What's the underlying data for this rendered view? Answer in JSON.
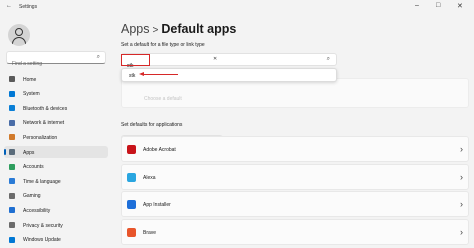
{
  "window": {
    "title": "Settings",
    "back_glyph": "←",
    "minimize_glyph": "–",
    "maximize_glyph": "□",
    "close_glyph": "✕"
  },
  "sidebar": {
    "search_placeholder": "Find a setting",
    "search_glyph": "⌕",
    "items": [
      {
        "label": "Home",
        "icon": "home-icon",
        "color": "#5a5a5a"
      },
      {
        "label": "System",
        "icon": "system-icon",
        "color": "#0078d4"
      },
      {
        "label": "Bluetooth & devices",
        "icon": "bluetooth-icon",
        "color": "#0a7fd6"
      },
      {
        "label": "Network & internet",
        "icon": "network-icon",
        "color": "#4a6da7"
      },
      {
        "label": "Personalization",
        "icon": "brush-icon",
        "color": "#d17a2b"
      },
      {
        "label": "Apps",
        "icon": "apps-icon",
        "color": "#5a6b7a",
        "active": true
      },
      {
        "label": "Accounts",
        "icon": "accounts-icon",
        "color": "#2e9e5e"
      },
      {
        "label": "Time & language",
        "icon": "time-icon",
        "color": "#2a7bd6"
      },
      {
        "label": "Gaming",
        "icon": "gaming-icon",
        "color": "#6b6b6b"
      },
      {
        "label": "Accessibility",
        "icon": "accessibility-icon",
        "color": "#1f6fd1"
      },
      {
        "label": "Privacy & security",
        "icon": "shield-icon",
        "color": "#6b6b6b"
      },
      {
        "label": "Windows Update",
        "icon": "update-icon",
        "color": "#0078d4"
      }
    ]
  },
  "main": {
    "breadcrumb_parent": "Apps",
    "breadcrumb_sep": ">",
    "breadcrumb_current": "Default apps",
    "filetype_heading": "Set a default for a file type or link type",
    "filetype_value": "stk",
    "clear_glyph": "✕",
    "search_glyph": "⌕",
    "suggestion": "stk",
    "ghost_text": "Choose a default",
    "apps_heading": "Set defaults for applications",
    "apps_search_placeholder": "Search apps",
    "chevron_glyph": "›",
    "apps": [
      {
        "name": "Adobe Acrobat",
        "icon": "adobe-acrobat-icon",
        "color": "#c8141a"
      },
      {
        "name": "Alexa",
        "icon": "alexa-icon",
        "color": "#2aa6e0"
      },
      {
        "name": "App Installer",
        "icon": "app-installer-icon",
        "color": "#1e6fd9"
      },
      {
        "name": "Brave",
        "icon": "brave-icon",
        "color": "#e8552b"
      }
    ]
  },
  "annotation_color": "#d62828"
}
